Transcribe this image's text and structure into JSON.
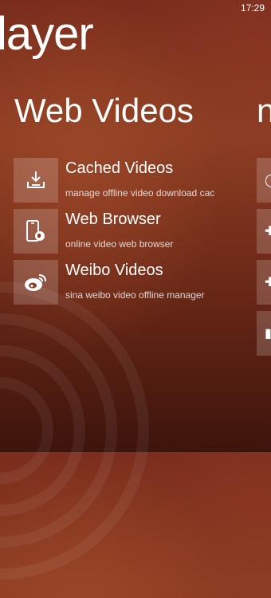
{
  "status": {
    "time": "17:29"
  },
  "app_title": "layer",
  "section_title": "Web Videos",
  "next_section_peek": "n",
  "items": [
    {
      "title": "Cached Videos",
      "subtitle": "manage offline video download cac",
      "icon": "download-icon"
    },
    {
      "title": "Web Browser",
      "subtitle": "online video web browser",
      "icon": "phone-globe-icon"
    },
    {
      "title": "Weibo Videos",
      "subtitle": "sina weibo video offline manager",
      "icon": "weibo-icon"
    }
  ],
  "colors": {
    "background": "#7a2d1c",
    "tile": "rgba(255,255,255,0.18)",
    "text": "#ffffff"
  }
}
